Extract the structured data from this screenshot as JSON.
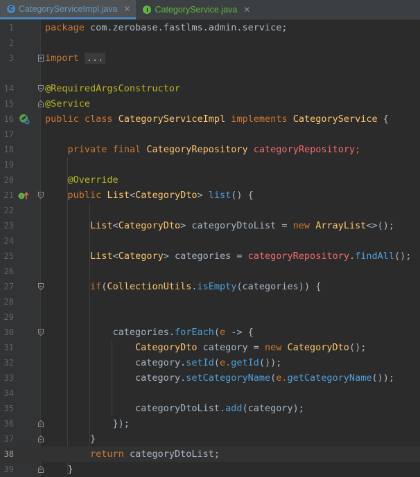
{
  "tabs": [
    {
      "label": "CategoryServiceImpl.java",
      "icon": "class-icon"
    },
    {
      "label": "CategoryService.java",
      "icon": "interface-icon"
    }
  ],
  "editor": {
    "current_line": "38",
    "lines": [
      {
        "n": "1"
      },
      {
        "n": "2"
      },
      {
        "n": "3"
      },
      {
        "n": "14"
      },
      {
        "n": "15"
      },
      {
        "n": "16"
      },
      {
        "n": "17"
      },
      {
        "n": "18"
      },
      {
        "n": "19"
      },
      {
        "n": "20"
      },
      {
        "n": "21"
      },
      {
        "n": "22"
      },
      {
        "n": "23"
      },
      {
        "n": "24"
      },
      {
        "n": "25"
      },
      {
        "n": "26"
      },
      {
        "n": "27"
      },
      {
        "n": "28"
      },
      {
        "n": "29"
      },
      {
        "n": "30"
      },
      {
        "n": "31"
      },
      {
        "n": "32"
      },
      {
        "n": "33"
      },
      {
        "n": "34"
      },
      {
        "n": "35"
      },
      {
        "n": "36"
      },
      {
        "n": "37"
      },
      {
        "n": "38"
      },
      {
        "n": "39"
      }
    ],
    "tokens": {
      "package_kw": "package",
      "package_name": " com.zerobase.fastlms.admin.service;",
      "import_kw": "import",
      "import_fold": "...",
      "anno_rac": "@RequiredArgsConstructor",
      "anno_service": "@Service",
      "public": "public",
      "class": "class",
      "class_name": "CategoryServiceImpl",
      "implements": "implements",
      "iface": "CategoryService",
      "brace_open": " {",
      "private": "private",
      "final": "final",
      "repo_type": "CategoryRepository",
      "repo_field": "categoryRepository",
      "semi": ";",
      "anno_override": "@Override",
      "list_type": "List",
      "lt": "<",
      "dto_type": "CategoryDto",
      "gt": ">",
      "list_method": "list",
      "list_sig_tail": "() {",
      "dto_list_var": " categoryDtoList = ",
      "new": "new",
      "arraylist": "ArrayList",
      "arraylist_tail": "<>();",
      "category_type": "Category",
      "categories_assign": " categories = ",
      "dot": ".",
      "find_all": "findAll",
      "call_end": "();",
      "if": "if",
      "if_open": "(",
      "collection_utils": "CollectionUtils",
      "is_empty": "isEmpty",
      "if_args": "(categories)) {",
      "categories_var": "categories.",
      "for_each": "forEach",
      "paren_open": "(",
      "lambda_param": "e",
      "lambda_arrow": " -> {",
      "category_assign": " category = ",
      "dto_ctor": "CategoryDto",
      "category_dot": "category.",
      "set_id": "setId",
      "e_dot": "e.",
      "get_id": "getId",
      "close2": "());",
      "set_category_name": "setCategoryName",
      "get_category_name": "getCategoryName",
      "dto_list_dot": "categoryDtoList.",
      "add": "add",
      "add_args": "(category);",
      "lambda_close": "});",
      "close_brace": "}",
      "return": "return",
      "return_val": " categoryDtoList;"
    }
  }
}
